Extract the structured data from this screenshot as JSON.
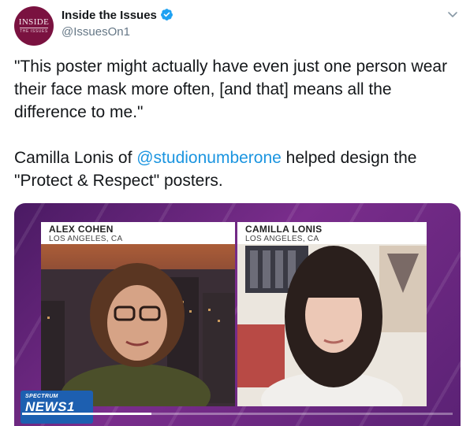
{
  "account": {
    "avatar_text_top": "INSIDE",
    "avatar_text_bottom": "THE ISSUES",
    "display_name": "Inside the Issues",
    "handle": "@IssuesOn1",
    "verified": true,
    "verified_icon": "verified-badge-icon",
    "menu_icon": "chevron-down-icon"
  },
  "tweet": {
    "quote": "\"This poster might actually have even just one person wear their face mask more often, [and that] means all the difference to me.\"",
    "line2_before": "Camilla Lonis of ",
    "mention": "@studionumberone",
    "line2_after": " helped design the \"Protect & Respect\" posters."
  },
  "video": {
    "left_speaker": {
      "name": "ALEX COHEN",
      "location": "LOS ANGELES, CA"
    },
    "right_speaker": {
      "name": "CAMILLA LONIS",
      "location": "LOS ANGELES, CA"
    },
    "logo_top": "SPECTRUM",
    "logo_main": "NEWS",
    "logo_number": "1",
    "progress": 0.3
  },
  "colors": {
    "link": "#1b95e0",
    "verified": "#1da1f2",
    "media_purple": "#5b2275",
    "logo_blue": "#1d5fb0"
  }
}
